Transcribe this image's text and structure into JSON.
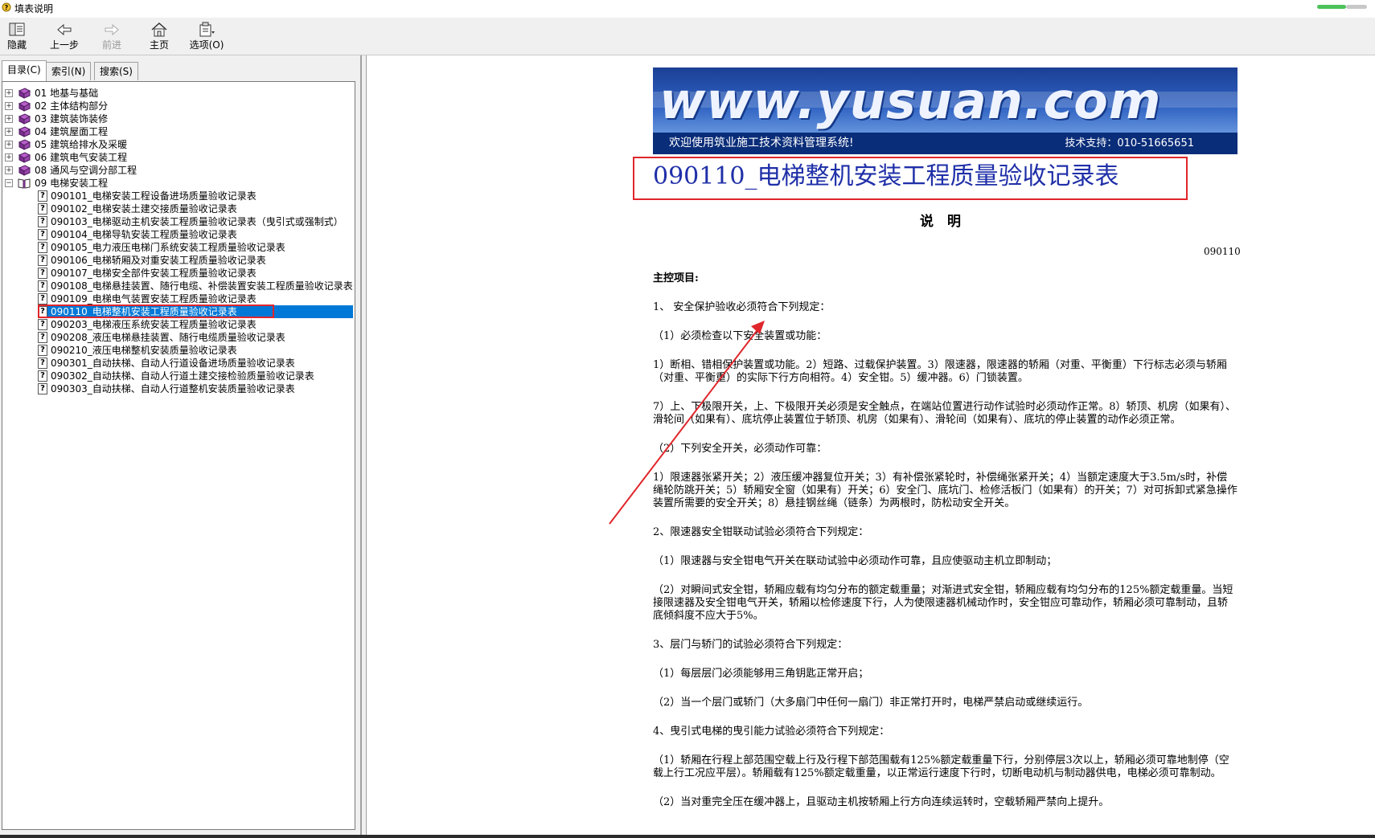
{
  "window": {
    "title": "填表说明"
  },
  "toolbar": {
    "buttons": [
      {
        "label": "隐藏",
        "icon": "hide-icon",
        "enabled": true
      },
      {
        "label": "上一步",
        "icon": "back-arrow-icon",
        "enabled": true
      },
      {
        "label": "前进",
        "icon": "forward-arrow-icon",
        "enabled": false
      },
      {
        "label": "主页",
        "icon": "home-icon",
        "enabled": true
      },
      {
        "label": "选项(O)",
        "icon": "options-icon",
        "enabled": true
      }
    ]
  },
  "tabs": [
    {
      "label": "目录(C)",
      "active": true
    },
    {
      "label": "索引(N)",
      "active": false
    },
    {
      "label": "搜索(S)",
      "active": false
    }
  ],
  "tree": {
    "categories": [
      "01  地基与基础",
      "02  主体结构部分",
      "03  建筑装饰装修",
      "04  建筑屋面工程",
      "05  建筑给排水及采暖",
      "06  建筑电气安装工程",
      "08  通风与空调分部工程",
      "09  电梯安装工程"
    ],
    "documents": [
      "090101_电梯安装工程设备进场质量验收记录表",
      "090102_电梯安装土建交接质量验收记录表",
      "090103_电梯驱动主机安装工程质量验收记录表（曳引式或强制式）",
      "090104_电梯导轨安装工程质量验收记录表",
      "090105_电力液压电梯门系统安装工程质量验收记录表",
      "090106_电梯轿厢及对重安装工程质量验收记录表",
      "090107_电梯安全部件安装工程质量验收记录表",
      "090108_电梯悬挂装置、随行电缆、补偿装置安装工程质量验收记录表",
      "090109_电梯电气装置安装工程质量验收记录表",
      "090110_电梯整机安装工程质量验收记录表",
      "090203_电梯液压系统安装工程质量验收记录表",
      "090208_液压电梯悬挂装置、随行电缆质量验收记录表",
      "090210_液压电梯整机安装质量验收记录表",
      "090301_自动扶梯、自动人行道设备进场质量验收记录表",
      "090302_自动扶梯、自动人行道土建交接检验质量验收记录表",
      "090303_自动扶梯、自动人行道整机安装质量验收记录表"
    ],
    "selected_document": "090110_电梯整机安装工程质量验收记录表"
  },
  "banner": {
    "logo": "www.yusuan.com",
    "welcome": "欢迎使用筑业施工技术资料管理系统!",
    "support": "技术支持：010-51665651"
  },
  "document": {
    "title": "090110_电梯整机安装工程质量验收记录表",
    "heading": "说　明",
    "code": "090110",
    "paragraphs": [
      "主控项目:",
      "1、 安全保护验收必须符合下列规定：",
      "（1）必须检查以下安全装置或功能：",
      "1）断相、错相保护装置或功能。2）短路、过载保护装置。3）限速器，限速器的轿厢（对重、平衡重）下行标志必须与轿厢（对重、平衡重）的实际下行方向相符。4）安全钳。5）缓冲器。6）门锁装置。",
      "7）上、下极限开关，上、下极限开关必须是安全触点，在端站位置进行动作试验时必须动作正常。8）轿顶、机房（如果有）、滑轮间（如果有）、底坑停止装置位于轿顶、机房（如果有）、滑轮间（如果有）、底坑的停止装置的动作必须正常。",
      "（2）下列安全开关，必须动作可靠：",
      "1）限速器张紧开关；2）液压缓冲器复位开关；3）有补偿张紧轮时，补偿绳张紧开关；4）当额定速度大于3.5m/s时，补偿绳轮防跳开关；5）轿厢安全窗（如果有）开关；6）安全门、底坑门、检修活板门（如果有）的开关；7）对可拆卸式紧急操作装置所需要的安全开关；8）悬挂钢丝绳（链条）为两根时，防松动安全开关。",
      "2、限速器安全钳联动试验必须符合下列规定：",
      "（1）限速器与安全钳电气开关在联动试验中必须动作可靠，且应使驱动主机立即制动；",
      "（2）对瞬间式安全钳，轿厢应载有均匀分布的额定载重量；对渐进式安全钳，轿厢应载有均匀分布的125%额定载重量。当短接限速器及安全钳电气开关，轿厢以检修速度下行，人为使限速器机械动作时，安全钳应可靠动作，轿厢必须可靠制动，且轿底倾斜度不应大于5%。",
      "3、层门与轿门的试验必须符合下列规定：",
      "（1）每层层门必须能够用三角钥匙正常开启；",
      "（2）当一个层门或轿门（大多扇门中任何一扇门）非正常打开时，电梯严禁启动或继续运行。",
      "4、曳引式电梯的曳引能力试验必须符合下列规定：",
      "（1）轿厢在行程上部范围空载上行及行程下部范围载有125%额定载重量下行，分别停层3次以上，轿厢必须可靠地制停（空载上行工况应平层）。轿厢载有125%额定载重量，以正常运行速度下行时，切断电动机与制动器供电，电梯必须可靠制动。",
      "（2）当对重完全压在缓冲器上，且驱动主机按轿厢上行方向连续运转时，空载轿厢严禁向上提升。"
    ]
  },
  "colors": {
    "selection": "#0078d7",
    "annotation_red": "#e0262b",
    "title_blue": "#1f2fa8",
    "banner_dark": "#0a2d79"
  }
}
